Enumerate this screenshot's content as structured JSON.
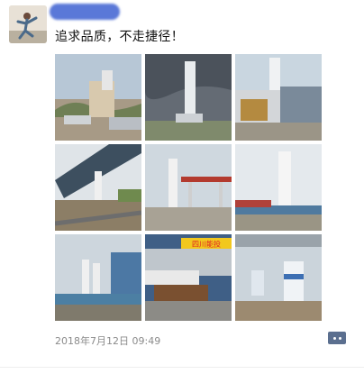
{
  "post": {
    "text": "追求品质，不走捷径！",
    "timestamp": "2018年7月12日 09:49"
  },
  "icons": {
    "more": "more-dots-icon"
  },
  "colors": {
    "name_blur": "#5a78d8",
    "timestamp": "#8b8b8b",
    "more_button": "#5b6f8f"
  },
  "gallery": {
    "photos": [
      {
        "subject": "lng-station-building",
        "sign_text": ""
      },
      {
        "subject": "vertical-tank-storm-sky",
        "sign_text": ""
      },
      {
        "subject": "tank-and-pump-skid",
        "sign_text": ""
      },
      {
        "subject": "tank-under-construction",
        "sign_text": ""
      },
      {
        "subject": "tank-and-canopy",
        "sign_text": ""
      },
      {
        "subject": "tank-behind-fence",
        "sign_text": ""
      },
      {
        "subject": "two-tanks-warehouse",
        "sign_text": ""
      },
      {
        "subject": "tanker-truck-canopy",
        "sign_text": "四川能投"
      },
      {
        "subject": "dispenser-under-canopy",
        "sign_text": ""
      }
    ]
  }
}
